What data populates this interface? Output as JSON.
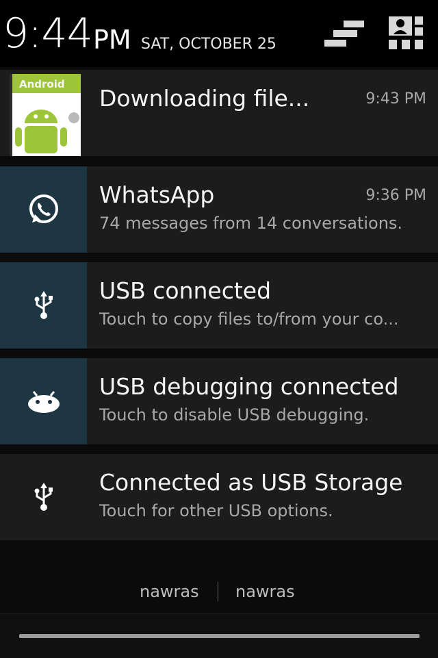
{
  "status_header": {
    "time": "9:44",
    "ampm": "PM",
    "date": "SAT, OCTOBER 25",
    "toggle_icon": "notification-clear-icon",
    "settings_icon": "quick-settings-icon"
  },
  "notifications": [
    {
      "title": "Downloading file...",
      "subtitle": "",
      "time": "9:43 PM",
      "icon": "android-download-thumbnail",
      "thumb_label": "Android"
    },
    {
      "title": "WhatsApp",
      "subtitle": "74 messages from 14 conversations.",
      "time": "9:36 PM",
      "icon": "whatsapp-icon"
    },
    {
      "title": "USB connected",
      "subtitle": "Touch to copy files to/from your co...",
      "time": "",
      "icon": "usb-icon"
    },
    {
      "title": "USB debugging connected",
      "subtitle": "Touch to disable USB debugging.",
      "time": "",
      "icon": "android-debug-icon"
    },
    {
      "title": "Connected as USB Storage",
      "subtitle": "Touch for other USB options.",
      "time": "",
      "icon": "usb-icon"
    }
  ],
  "carriers": [
    "nawras",
    "nawras"
  ],
  "colors": {
    "icon_bg_accent": "#1d3642",
    "notif_bg": "#1c1c1c",
    "android_green": "#9ec43a"
  }
}
